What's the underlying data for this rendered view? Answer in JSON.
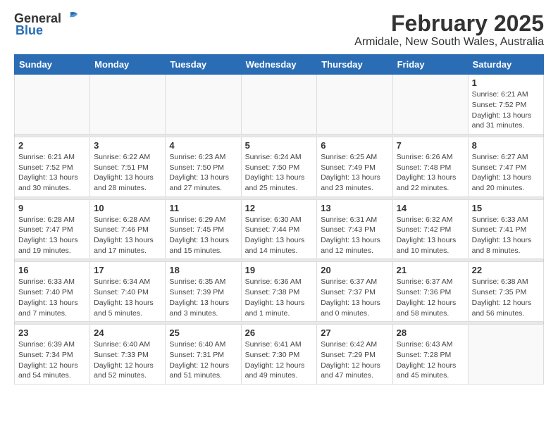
{
  "header": {
    "logo_general": "General",
    "logo_blue": "Blue",
    "title": "February 2025",
    "subtitle": "Armidale, New South Wales, Australia"
  },
  "days_of_week": [
    "Sunday",
    "Monday",
    "Tuesday",
    "Wednesday",
    "Thursday",
    "Friday",
    "Saturday"
  ],
  "weeks": [
    [
      {
        "day": "",
        "info": ""
      },
      {
        "day": "",
        "info": ""
      },
      {
        "day": "",
        "info": ""
      },
      {
        "day": "",
        "info": ""
      },
      {
        "day": "",
        "info": ""
      },
      {
        "day": "",
        "info": ""
      },
      {
        "day": "1",
        "info": "Sunrise: 6:21 AM\nSunset: 7:52 PM\nDaylight: 13 hours\nand 31 minutes."
      }
    ],
    [
      {
        "day": "2",
        "info": "Sunrise: 6:21 AM\nSunset: 7:52 PM\nDaylight: 13 hours\nand 30 minutes."
      },
      {
        "day": "3",
        "info": "Sunrise: 6:22 AM\nSunset: 7:51 PM\nDaylight: 13 hours\nand 28 minutes."
      },
      {
        "day": "4",
        "info": "Sunrise: 6:23 AM\nSunset: 7:50 PM\nDaylight: 13 hours\nand 27 minutes."
      },
      {
        "day": "5",
        "info": "Sunrise: 6:24 AM\nSunset: 7:50 PM\nDaylight: 13 hours\nand 25 minutes."
      },
      {
        "day": "6",
        "info": "Sunrise: 6:25 AM\nSunset: 7:49 PM\nDaylight: 13 hours\nand 23 minutes."
      },
      {
        "day": "7",
        "info": "Sunrise: 6:26 AM\nSunset: 7:48 PM\nDaylight: 13 hours\nand 22 minutes."
      },
      {
        "day": "8",
        "info": "Sunrise: 6:27 AM\nSunset: 7:47 PM\nDaylight: 13 hours\nand 20 minutes."
      }
    ],
    [
      {
        "day": "9",
        "info": "Sunrise: 6:28 AM\nSunset: 7:47 PM\nDaylight: 13 hours\nand 19 minutes."
      },
      {
        "day": "10",
        "info": "Sunrise: 6:28 AM\nSunset: 7:46 PM\nDaylight: 13 hours\nand 17 minutes."
      },
      {
        "day": "11",
        "info": "Sunrise: 6:29 AM\nSunset: 7:45 PM\nDaylight: 13 hours\nand 15 minutes."
      },
      {
        "day": "12",
        "info": "Sunrise: 6:30 AM\nSunset: 7:44 PM\nDaylight: 13 hours\nand 14 minutes."
      },
      {
        "day": "13",
        "info": "Sunrise: 6:31 AM\nSunset: 7:43 PM\nDaylight: 13 hours\nand 12 minutes."
      },
      {
        "day": "14",
        "info": "Sunrise: 6:32 AM\nSunset: 7:42 PM\nDaylight: 13 hours\nand 10 minutes."
      },
      {
        "day": "15",
        "info": "Sunrise: 6:33 AM\nSunset: 7:41 PM\nDaylight: 13 hours\nand 8 minutes."
      }
    ],
    [
      {
        "day": "16",
        "info": "Sunrise: 6:33 AM\nSunset: 7:40 PM\nDaylight: 13 hours\nand 7 minutes."
      },
      {
        "day": "17",
        "info": "Sunrise: 6:34 AM\nSunset: 7:40 PM\nDaylight: 13 hours\nand 5 minutes."
      },
      {
        "day": "18",
        "info": "Sunrise: 6:35 AM\nSunset: 7:39 PM\nDaylight: 13 hours\nand 3 minutes."
      },
      {
        "day": "19",
        "info": "Sunrise: 6:36 AM\nSunset: 7:38 PM\nDaylight: 13 hours\nand 1 minute."
      },
      {
        "day": "20",
        "info": "Sunrise: 6:37 AM\nSunset: 7:37 PM\nDaylight: 13 hours\nand 0 minutes."
      },
      {
        "day": "21",
        "info": "Sunrise: 6:37 AM\nSunset: 7:36 PM\nDaylight: 12 hours\nand 58 minutes."
      },
      {
        "day": "22",
        "info": "Sunrise: 6:38 AM\nSunset: 7:35 PM\nDaylight: 12 hours\nand 56 minutes."
      }
    ],
    [
      {
        "day": "23",
        "info": "Sunrise: 6:39 AM\nSunset: 7:34 PM\nDaylight: 12 hours\nand 54 minutes."
      },
      {
        "day": "24",
        "info": "Sunrise: 6:40 AM\nSunset: 7:33 PM\nDaylight: 12 hours\nand 52 minutes."
      },
      {
        "day": "25",
        "info": "Sunrise: 6:40 AM\nSunset: 7:31 PM\nDaylight: 12 hours\nand 51 minutes."
      },
      {
        "day": "26",
        "info": "Sunrise: 6:41 AM\nSunset: 7:30 PM\nDaylight: 12 hours\nand 49 minutes."
      },
      {
        "day": "27",
        "info": "Sunrise: 6:42 AM\nSunset: 7:29 PM\nDaylight: 12 hours\nand 47 minutes."
      },
      {
        "day": "28",
        "info": "Sunrise: 6:43 AM\nSunset: 7:28 PM\nDaylight: 12 hours\nand 45 minutes."
      },
      {
        "day": "",
        "info": ""
      }
    ]
  ]
}
